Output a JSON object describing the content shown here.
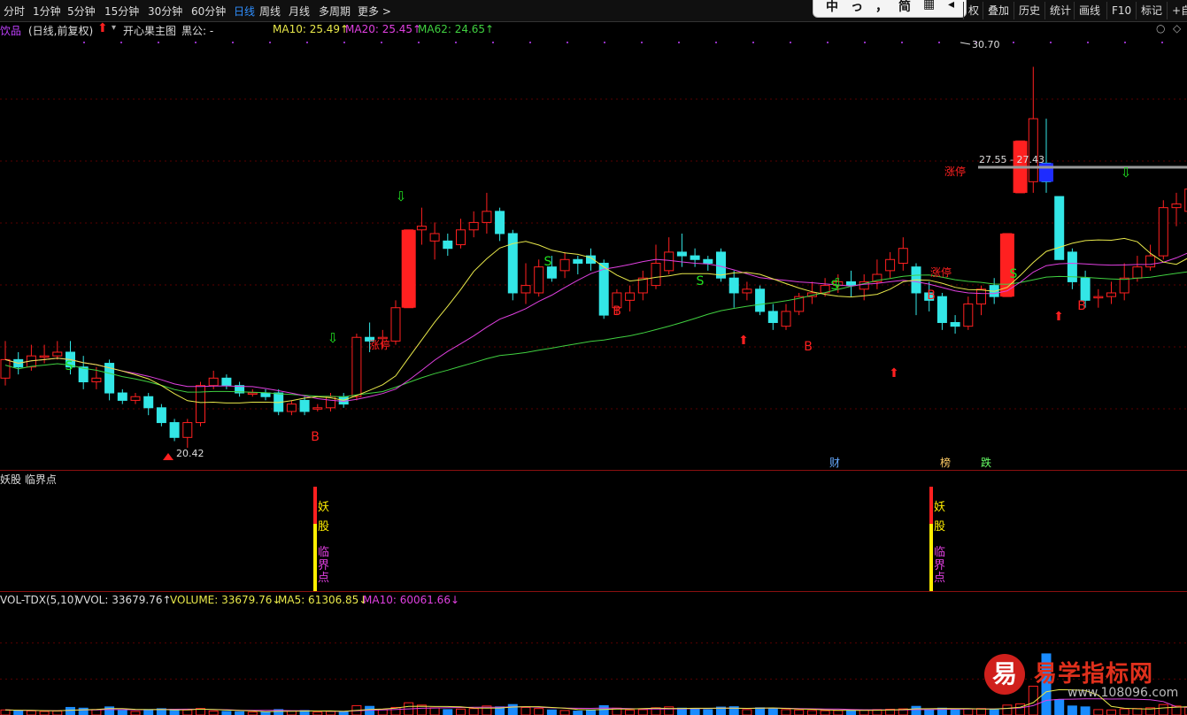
{
  "toolbar": {
    "periods": [
      "分时",
      "1分钟",
      "5分钟",
      "15分钟",
      "30分钟",
      "60分钟",
      "日线",
      "周线",
      "月线",
      "多周期",
      "更多 >"
    ],
    "active_period": "日线",
    "overlay_chars": [
      "中",
      "っ",
      "，",
      "简",
      "▦",
      "◂"
    ],
    "right_tools": [
      "权",
      "叠加",
      "历史",
      "统计",
      "画线",
      "F10",
      "标记",
      "+自"
    ]
  },
  "info": {
    "stock_name": "饮品",
    "mode": "(日线,前复权)",
    "indicator_name": "开心果主图",
    "indicator_value": "黒公: -",
    "ma10": "MA10: 25.49↑",
    "ma20": "MA20: 25.45↑",
    "ma62": "MA62: 24.65↑",
    "corner_icons": [
      "○",
      "◇"
    ]
  },
  "colors": {
    "up": "#ff2020",
    "down": "#33e6e6",
    "ma10": "#e8e84a",
    "ma20": "#e040e0",
    "ma62": "#40d040",
    "grid": "#5a0000",
    "sep": "#8a1010",
    "signal_b": "#ff2020",
    "signal_s": "#20e020",
    "limit_text": "#ff2020"
  },
  "main_chart": {
    "high_label": "30.70",
    "low_label": "20.42",
    "resistance_label": "27.55 - 27.43",
    "limit_up_label": "涨停",
    "buy_label": "B",
    "sell_label": "S",
    "event_tags": [
      "财",
      "榜",
      "跌"
    ],
    "ylim": [
      19.8,
      31.5
    ]
  },
  "mid_panel": {
    "title": "妖股 临界点",
    "signal_chars": [
      "妖",
      "股",
      "临",
      "界",
      "点"
    ]
  },
  "vol_panel": {
    "name": "VOL-TDX(5,10)",
    "vvol": "VVOL: 33679.76↑",
    "volume": "VOLUME: 33679.76↓",
    "ma5": "MA5: 61306.85↓",
    "ma10": "MA10: 60061.66↓"
  },
  "watermark": {
    "logo_char": "易",
    "text": "易学指标网",
    "url": "www.108096.com"
  },
  "chart_data": {
    "type": "candlestick",
    "ylim": [
      19.8,
      31.5
    ],
    "candles": [
      {
        "o": 22.3,
        "c": 22.8,
        "h": 23.3,
        "l": 22.1,
        "v": 28000
      },
      {
        "o": 22.8,
        "c": 22.6,
        "h": 23.0,
        "l": 22.4,
        "v": 25000
      },
      {
        "o": 22.6,
        "c": 22.9,
        "h": 23.2,
        "l": 22.5,
        "v": 23000
      },
      {
        "o": 22.9,
        "c": 22.9,
        "h": 23.2,
        "l": 22.7,
        "v": 20000
      },
      {
        "o": 22.9,
        "c": 23.0,
        "h": 23.3,
        "l": 22.8,
        "v": 22000
      },
      {
        "o": 23.0,
        "c": 22.6,
        "h": 23.3,
        "l": 22.4,
        "v": 42000
      },
      {
        "o": 22.6,
        "c": 22.2,
        "h": 22.9,
        "l": 22.0,
        "v": 38000
      },
      {
        "o": 22.2,
        "c": 22.3,
        "h": 22.6,
        "l": 22.0,
        "v": 30000
      },
      {
        "o": 22.7,
        "c": 21.9,
        "h": 22.8,
        "l": 21.7,
        "v": 45000
      },
      {
        "o": 21.9,
        "c": 21.7,
        "h": 22.0,
        "l": 21.6,
        "v": 25000
      },
      {
        "o": 21.7,
        "c": 21.8,
        "h": 21.9,
        "l": 21.6,
        "v": 20000
      },
      {
        "o": 21.8,
        "c": 21.5,
        "h": 21.9,
        "l": 21.3,
        "v": 30000
      },
      {
        "o": 21.5,
        "c": 21.1,
        "h": 21.6,
        "l": 21.0,
        "v": 35000
      },
      {
        "o": 21.1,
        "c": 20.7,
        "h": 21.2,
        "l": 20.6,
        "v": 32000
      },
      {
        "o": 20.7,
        "c": 21.1,
        "h": 21.2,
        "l": 20.42,
        "v": 28000
      },
      {
        "o": 21.1,
        "c": 22.1,
        "h": 22.2,
        "l": 21.0,
        "v": 36000
      },
      {
        "o": 22.1,
        "c": 22.3,
        "h": 22.5,
        "l": 22.0,
        "v": 22000
      },
      {
        "o": 22.3,
        "c": 22.1,
        "h": 22.4,
        "l": 22.0,
        "v": 20000
      },
      {
        "o": 22.1,
        "c": 21.9,
        "h": 22.2,
        "l": 21.8,
        "v": 18000
      },
      {
        "o": 21.9,
        "c": 21.9,
        "h": 22.0,
        "l": 21.8,
        "v": 16000
      },
      {
        "o": 21.9,
        "c": 21.8,
        "h": 22.0,
        "l": 21.7,
        "v": 17000
      },
      {
        "o": 21.9,
        "c": 21.4,
        "h": 22.0,
        "l": 21.3,
        "v": 30000
      },
      {
        "o": 21.4,
        "c": 21.6,
        "h": 21.7,
        "l": 21.3,
        "v": 22000
      },
      {
        "o": 21.7,
        "c": 21.4,
        "h": 21.8,
        "l": 21.3,
        "v": 25000
      },
      {
        "o": 21.5,
        "c": 21.5,
        "h": 21.6,
        "l": 21.4,
        "v": 16000
      },
      {
        "o": 21.5,
        "c": 21.8,
        "h": 21.9,
        "l": 21.4,
        "v": 20000
      },
      {
        "o": 21.8,
        "c": 21.6,
        "h": 21.9,
        "l": 21.5,
        "v": 18000
      },
      {
        "o": 21.8,
        "c": 23.4,
        "h": 23.5,
        "l": 21.7,
        "v": 52000
      },
      {
        "o": 23.4,
        "c": 23.3,
        "h": 23.8,
        "l": 23.0,
        "v": 48000
      },
      {
        "o": 23.4,
        "c": 23.4,
        "h": 23.6,
        "l": 23.1,
        "v": 30000
      },
      {
        "o": 23.3,
        "c": 24.2,
        "h": 24.4,
        "l": 23.2,
        "v": 42000
      },
      {
        "o": 24.2,
        "c": 26.3,
        "h": 26.3,
        "l": 24.2,
        "v": 68000
      },
      {
        "o": 26.3,
        "c": 26.4,
        "h": 26.9,
        "l": 25.9,
        "v": 55000
      },
      {
        "o": 26.0,
        "c": 26.2,
        "h": 26.5,
        "l": 25.5,
        "v": 40000
      },
      {
        "o": 26.0,
        "c": 25.8,
        "h": 26.2,
        "l": 25.6,
        "v": 30000
      },
      {
        "o": 25.9,
        "c": 26.3,
        "h": 26.6,
        "l": 25.8,
        "v": 33000
      },
      {
        "o": 26.3,
        "c": 26.5,
        "h": 26.8,
        "l": 26.1,
        "v": 36000
      },
      {
        "o": 26.5,
        "c": 26.8,
        "h": 27.3,
        "l": 26.2,
        "v": 50000
      },
      {
        "o": 26.8,
        "c": 26.2,
        "h": 26.9,
        "l": 26.0,
        "v": 45000
      },
      {
        "o": 26.2,
        "c": 24.6,
        "h": 26.3,
        "l": 24.4,
        "v": 58000
      },
      {
        "o": 24.6,
        "c": 24.8,
        "h": 25.4,
        "l": 24.3,
        "v": 42000
      },
      {
        "o": 24.6,
        "c": 25.3,
        "h": 25.5,
        "l": 24.5,
        "v": 36000
      },
      {
        "o": 25.3,
        "c": 25.0,
        "h": 25.6,
        "l": 24.9,
        "v": 28000
      },
      {
        "o": 25.2,
        "c": 25.5,
        "h": 25.7,
        "l": 25.0,
        "v": 25000
      },
      {
        "o": 25.5,
        "c": 25.4,
        "h": 25.6,
        "l": 25.1,
        "v": 22000
      },
      {
        "o": 25.6,
        "c": 25.4,
        "h": 25.8,
        "l": 25.2,
        "v": 28000
      },
      {
        "o": 25.4,
        "c": 24.0,
        "h": 25.5,
        "l": 23.9,
        "v": 52000
      },
      {
        "o": 24.2,
        "c": 24.6,
        "h": 24.7,
        "l": 24.0,
        "v": 38000
      },
      {
        "o": 24.4,
        "c": 24.6,
        "h": 24.8,
        "l": 24.1,
        "v": 28000
      },
      {
        "o": 24.6,
        "c": 25.0,
        "h": 25.2,
        "l": 24.4,
        "v": 30000
      },
      {
        "o": 24.8,
        "c": 25.4,
        "h": 25.9,
        "l": 24.7,
        "v": 40000
      },
      {
        "o": 25.2,
        "c": 25.7,
        "h": 26.1,
        "l": 25.1,
        "v": 45000
      },
      {
        "o": 25.7,
        "c": 25.6,
        "h": 26.2,
        "l": 25.3,
        "v": 38000
      },
      {
        "o": 25.6,
        "c": 25.5,
        "h": 25.8,
        "l": 25.3,
        "v": 34000
      },
      {
        "o": 25.5,
        "c": 25.4,
        "h": 25.6,
        "l": 25.2,
        "v": 30000
      },
      {
        "o": 25.7,
        "c": 25.0,
        "h": 25.8,
        "l": 24.9,
        "v": 44000
      },
      {
        "o": 25.0,
        "c": 24.6,
        "h": 25.2,
        "l": 24.2,
        "v": 46000
      },
      {
        "o": 24.6,
        "c": 24.7,
        "h": 24.9,
        "l": 24.4,
        "v": 30000
      },
      {
        "o": 24.7,
        "c": 24.1,
        "h": 24.8,
        "l": 24.0,
        "v": 40000
      },
      {
        "o": 24.1,
        "c": 23.8,
        "h": 24.3,
        "l": 23.6,
        "v": 36000
      },
      {
        "o": 23.7,
        "c": 24.1,
        "h": 24.3,
        "l": 23.6,
        "v": 30000
      },
      {
        "o": 24.1,
        "c": 24.5,
        "h": 24.6,
        "l": 24.0,
        "v": 28000
      },
      {
        "o": 24.5,
        "c": 24.6,
        "h": 24.9,
        "l": 24.3,
        "v": 25000
      },
      {
        "o": 24.6,
        "c": 24.8,
        "h": 25.0,
        "l": 24.5,
        "v": 24000
      },
      {
        "o": 24.8,
        "c": 24.9,
        "h": 25.1,
        "l": 24.6,
        "v": 25000
      },
      {
        "o": 24.9,
        "c": 24.8,
        "h": 25.2,
        "l": 24.5,
        "v": 26000
      },
      {
        "o": 24.7,
        "c": 24.9,
        "h": 25.1,
        "l": 24.4,
        "v": 28000
      },
      {
        "o": 24.9,
        "c": 25.1,
        "h": 25.5,
        "l": 24.7,
        "v": 30000
      },
      {
        "o": 25.2,
        "c": 25.5,
        "h": 25.7,
        "l": 25.0,
        "v": 32000
      },
      {
        "o": 25.4,
        "c": 25.8,
        "h": 26.1,
        "l": 25.2,
        "v": 34000
      },
      {
        "o": 25.3,
        "c": 24.6,
        "h": 25.4,
        "l": 24.0,
        "v": 48000
      },
      {
        "o": 24.6,
        "c": 24.4,
        "h": 24.9,
        "l": 24.1,
        "v": 30000
      },
      {
        "o": 24.5,
        "c": 23.8,
        "h": 24.6,
        "l": 23.6,
        "v": 38000
      },
      {
        "o": 23.8,
        "c": 23.7,
        "h": 24.0,
        "l": 23.5,
        "v": 28000
      },
      {
        "o": 23.7,
        "c": 24.3,
        "h": 24.5,
        "l": 23.6,
        "v": 34000
      },
      {
        "o": 24.3,
        "c": 24.7,
        "h": 24.8,
        "l": 24.0,
        "v": 36000
      },
      {
        "o": 24.8,
        "c": 24.5,
        "h": 25.0,
        "l": 24.3,
        "v": 30000
      },
      {
        "o": 24.5,
        "c": 26.2,
        "h": 26.2,
        "l": 24.5,
        "v": 55000
      },
      {
        "o": 27.3,
        "c": 28.7,
        "h": 28.7,
        "l": 27.3,
        "v": 62000
      },
      {
        "o": 27.6,
        "c": 29.3,
        "h": 30.7,
        "l": 27.3,
        "v": 160000
      },
      {
        "o": 28.1,
        "c": 27.6,
        "h": 29.3,
        "l": 27.3,
        "v": 95000
      },
      {
        "o": 27.2,
        "c": 25.5,
        "h": 27.2,
        "l": 25.5,
        "v": 85000
      },
      {
        "o": 25.7,
        "c": 24.9,
        "h": 25.8,
        "l": 24.7,
        "v": 50000
      },
      {
        "o": 25.0,
        "c": 24.4,
        "h": 25.2,
        "l": 24.2,
        "v": 45000
      },
      {
        "o": 24.5,
        "c": 24.5,
        "h": 24.7,
        "l": 24.2,
        "v": 30000
      },
      {
        "o": 24.5,
        "c": 24.6,
        "h": 24.9,
        "l": 24.3,
        "v": 28000
      },
      {
        "o": 24.6,
        "c": 25.0,
        "h": 25.4,
        "l": 24.4,
        "v": 34000
      },
      {
        "o": 25.0,
        "c": 25.3,
        "h": 25.6,
        "l": 24.9,
        "v": 36000
      },
      {
        "o": 25.3,
        "c": 25.6,
        "h": 25.9,
        "l": 25.2,
        "v": 40000
      },
      {
        "o": 25.6,
        "c": 26.9,
        "h": 27.1,
        "l": 25.5,
        "v": 58000
      },
      {
        "o": 26.9,
        "c": 27.0,
        "h": 27.3,
        "l": 26.4,
        "v": 50000
      },
      {
        "o": 26.8,
        "c": 27.4,
        "h": 27.6,
        "l": 26.6,
        "v": 45000
      },
      {
        "o": 26.7,
        "c": 27.0,
        "h": 27.4,
        "l": 26.5,
        "v": 38000
      },
      {
        "o": 27.0,
        "c": 26.8,
        "h": 27.0,
        "l": 26.5,
        "v": 33679.76
      }
    ],
    "ma10_label": "MA10",
    "ma20_label": "MA20",
    "ma62_label": "MA62"
  }
}
